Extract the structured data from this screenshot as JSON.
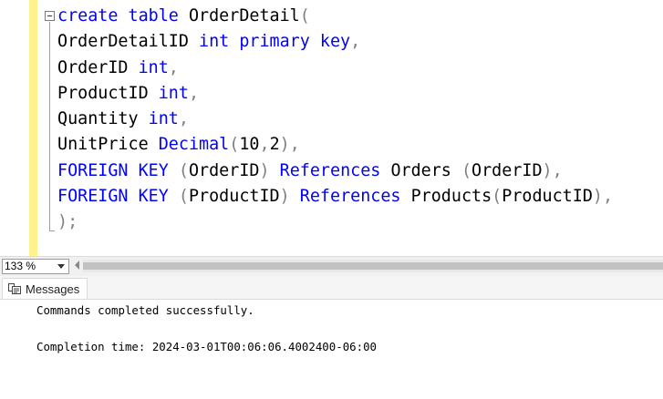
{
  "editor": {
    "lines": [
      [
        {
          "t": "create",
          "c": "kw"
        },
        {
          "t": " "
        },
        {
          "t": "table",
          "c": "kw"
        },
        {
          "t": " OrderDetail"
        },
        {
          "t": "(",
          "c": "gy"
        }
      ],
      [
        {
          "t": "OrderDetailID "
        },
        {
          "t": "int",
          "c": "kw"
        },
        {
          "t": " "
        },
        {
          "t": "primary",
          "c": "kw"
        },
        {
          "t": " "
        },
        {
          "t": "key",
          "c": "kw"
        },
        {
          "t": ",",
          "c": "gy"
        }
      ],
      [
        {
          "t": "OrderID "
        },
        {
          "t": "int",
          "c": "kw"
        },
        {
          "t": ",",
          "c": "gy"
        }
      ],
      [
        {
          "t": "ProductID "
        },
        {
          "t": "int",
          "c": "kw"
        },
        {
          "t": ",",
          "c": "gy"
        }
      ],
      [
        {
          "t": "Quantity "
        },
        {
          "t": "int",
          "c": "kw"
        },
        {
          "t": ",",
          "c": "gy"
        }
      ],
      [
        {
          "t": "UnitPrice "
        },
        {
          "t": "Decimal",
          "c": "kw"
        },
        {
          "t": "(",
          "c": "gy"
        },
        {
          "t": "10"
        },
        {
          "t": ",",
          "c": "gy"
        },
        {
          "t": "2"
        },
        {
          "t": "),",
          "c": "gy"
        }
      ],
      [
        {
          "t": "FOREIGN",
          "c": "kw"
        },
        {
          "t": " "
        },
        {
          "t": "KEY",
          "c": "kw"
        },
        {
          "t": " "
        },
        {
          "t": "(",
          "c": "gy"
        },
        {
          "t": "OrderID"
        },
        {
          "t": ")",
          "c": "gy"
        },
        {
          "t": " "
        },
        {
          "t": "References",
          "c": "kw"
        },
        {
          "t": " Orders "
        },
        {
          "t": "(",
          "c": "gy"
        },
        {
          "t": "OrderID"
        },
        {
          "t": "),",
          "c": "gy"
        }
      ],
      [
        {
          "t": "FOREIGN",
          "c": "kw"
        },
        {
          "t": " "
        },
        {
          "t": "KEY",
          "c": "kw"
        },
        {
          "t": " "
        },
        {
          "t": "(",
          "c": "gy"
        },
        {
          "t": "ProductID"
        },
        {
          "t": ")",
          "c": "gy"
        },
        {
          "t": " "
        },
        {
          "t": "References",
          "c": "kw"
        },
        {
          "t": " Products"
        },
        {
          "t": "(",
          "c": "gy"
        },
        {
          "t": "ProductID"
        },
        {
          "t": "),",
          "c": "gy"
        }
      ],
      [
        {
          "t": ");",
          "c": "gy"
        }
      ]
    ]
  },
  "status": {
    "zoom": "133 %"
  },
  "results": {
    "tab_label": "Messages",
    "message": "Commands completed successfully.",
    "completion": "Completion time: 2024-03-01T00:06:06.4002400-06:00"
  },
  "colors": {
    "keyword": "#0000ff",
    "operator": "#808080",
    "change_bar": "#fff28d"
  },
  "icons": {
    "fold": "collapse-minus-icon",
    "messages": "messages-icon",
    "dropdown": "chevron-down-icon",
    "scroll_left": "scroll-left-arrow-icon"
  }
}
